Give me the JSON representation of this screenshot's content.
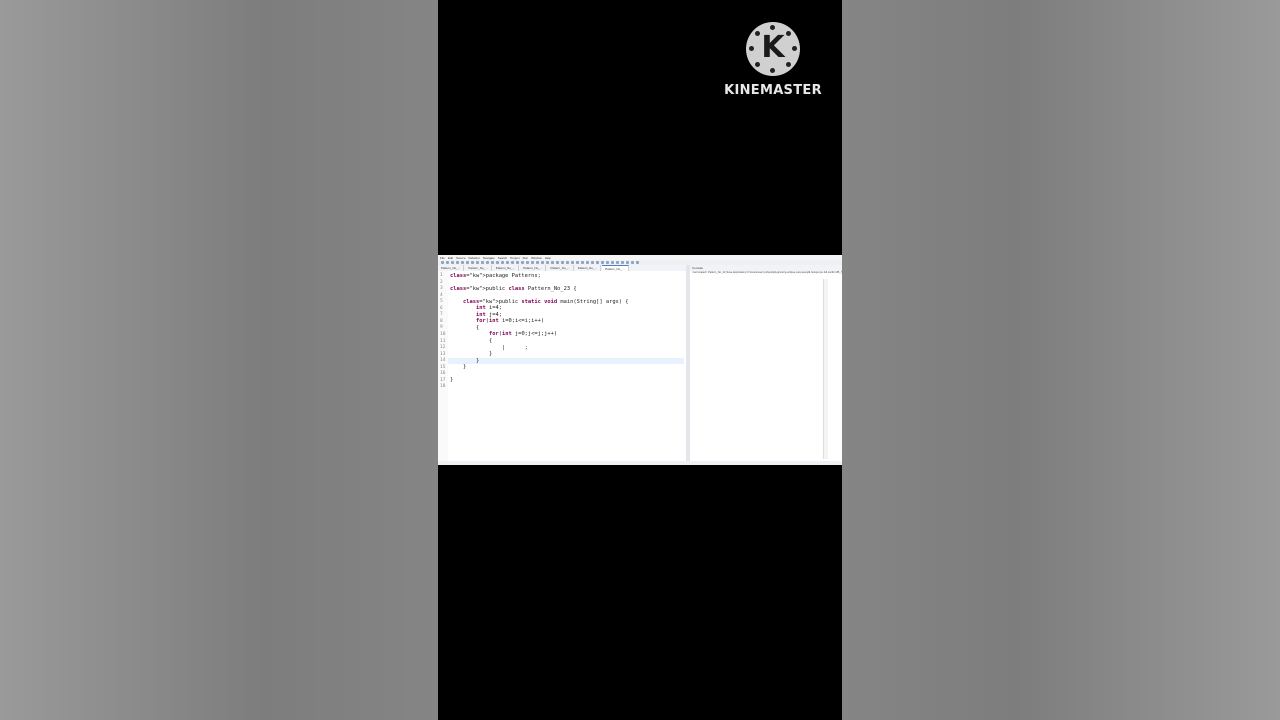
{
  "watermark": {
    "logo_letter": "K",
    "brand": "KINEMASTER"
  },
  "ide": {
    "menu": [
      "File",
      "Edit",
      "Source",
      "Refactor",
      "Navigate",
      "Search",
      "Project",
      "Run",
      "Window",
      "Help"
    ],
    "tabs": [
      "Pattern_No_...",
      "Pattern_No_...",
      "Pattern_No_...",
      "Pattern_No_...",
      "Pattern_No_...",
      "Pattern_No_...",
      "Pattern_No_..."
    ],
    "active_tab_index": 6,
    "editor_lines": [
      {
        "num": "1",
        "text": "package Patterns;"
      },
      {
        "num": "2",
        "text": ""
      },
      {
        "num": "3",
        "text": "public class Pattern_No_23 {"
      },
      {
        "num": "4",
        "text": ""
      },
      {
        "num": "5",
        "text": "    public static void main(String[] args) {"
      },
      {
        "num": "6",
        "text": "        int i=4;"
      },
      {
        "num": "7",
        "text": "        int j=4;"
      },
      {
        "num": "8",
        "text": "        for(int i=0;i<=i;i++)"
      },
      {
        "num": "9",
        "text": "        {"
      },
      {
        "num": "10",
        "text": "            for(int j=0;j<=j;j++)"
      },
      {
        "num": "11",
        "text": "            {"
      },
      {
        "num": "12",
        "text": "                |      ;"
      },
      {
        "num": "13",
        "text": "            }"
      },
      {
        "num": "14",
        "text": "        }"
      },
      {
        "num": "15",
        "text": "    }"
      },
      {
        "num": "16",
        "text": ""
      },
      {
        "num": "17",
        "text": "}"
      },
      {
        "num": "18",
        "text": ""
      }
    ],
    "console": {
      "tab_label": "Console",
      "line": "<terminated> Pattern_No_22 [Java Application] C:\\Users\\user\\.p2\\pool\\plugins\\org.eclipse.justj.openjdk.hotspot.jre.full.win32.x86_64"
    }
  }
}
